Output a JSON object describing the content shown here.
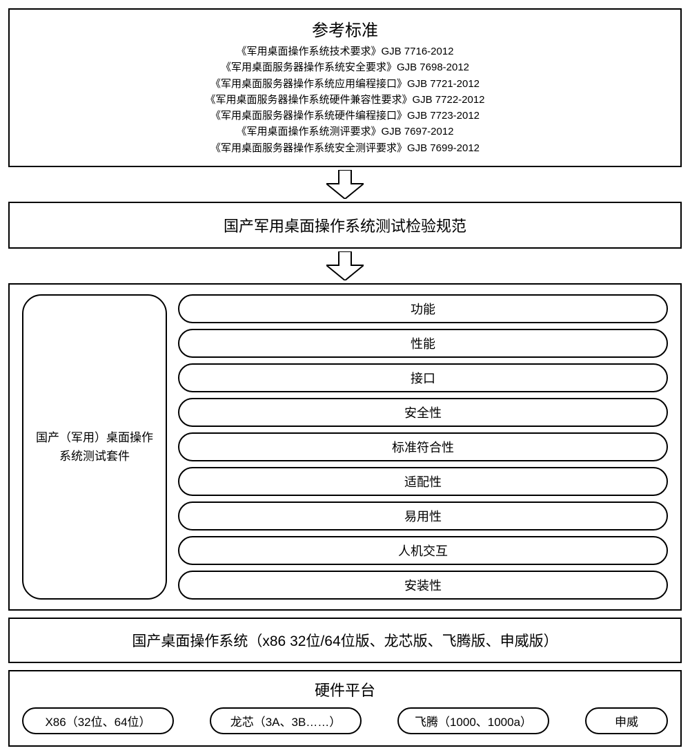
{
  "standards": {
    "title": "参考标准",
    "items": [
      "《军用桌面操作系统技术要求》GJB 7716-2012",
      "《军用桌面服务器操作系统安全要求》GJB 7698-2012",
      "《军用桌面服务器操作系统应用编程接口》GJB 7721-2012",
      "《军用桌面服务器操作系统硬件兼容性要求》GJB 7722-2012",
      "《军用桌面服务器操作系统硬件编程接口》GJB 7723-2012",
      "《军用桌面操作系统测评要求》GJB 7697-2012",
      "《军用桌面服务器操作系统安全测评要求》GJB 7699-2012"
    ]
  },
  "spec": {
    "label": "国产军用桌面操作系统测试检验规范"
  },
  "suite": {
    "left_line1": "国产（军用）桌面操作",
    "left_line2": "系统测试套件",
    "items": [
      "功能",
      "性能",
      "接口",
      "安全性",
      "标准符合性",
      "适配性",
      "易用性",
      "人机交互",
      "安装性"
    ]
  },
  "os": {
    "label": "国产桌面操作系统（x86 32位/64位版、龙芯版、飞腾版、申威版）"
  },
  "hw": {
    "title": "硬件平台",
    "items": [
      "X86（32位、64位）",
      "龙芯（3A、3B……）",
      "飞腾（1000、1000a）",
      "申威"
    ]
  }
}
